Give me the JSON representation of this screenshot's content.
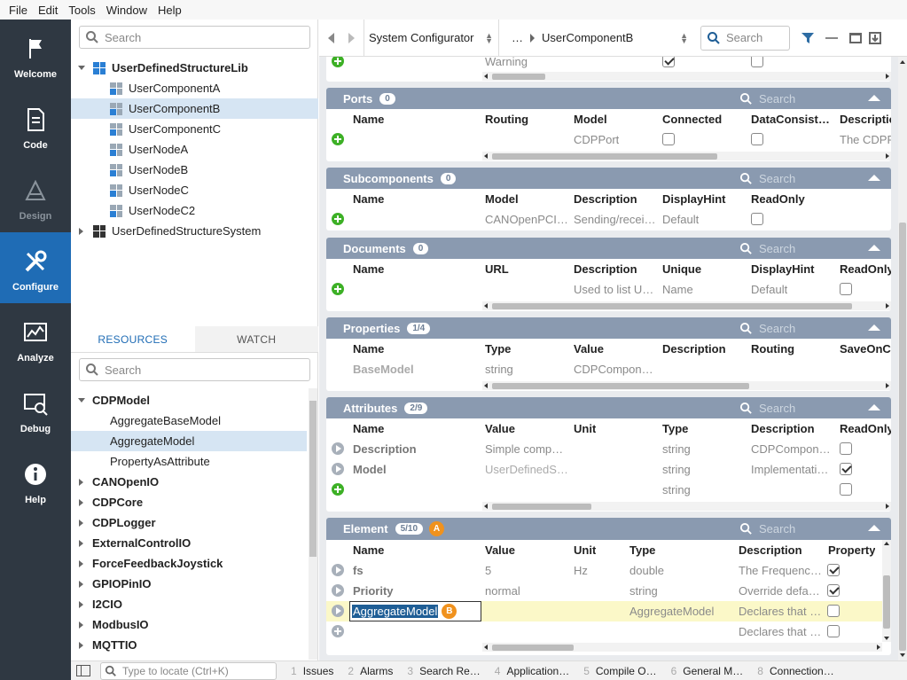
{
  "menu": {
    "file": "File",
    "edit": "Edit",
    "tools": "Tools",
    "window": "Window",
    "help": "Help"
  },
  "nav": {
    "welcome": "Welcome",
    "code": "Code",
    "design": "Design",
    "configure": "Configure",
    "analyze": "Analyze",
    "debug": "Debug",
    "help": "Help"
  },
  "tree": {
    "search_placeholder": "Search",
    "lib": "UserDefinedStructureLib",
    "items": [
      "UserComponentA",
      "UserComponentB",
      "UserComponentC",
      "UserNodeA",
      "UserNodeB",
      "UserNodeC",
      "UserNodeC2"
    ],
    "system": "UserDefinedStructureSystem"
  },
  "restabs": {
    "resources": "RESOURCES",
    "watch": "WATCH"
  },
  "resources": {
    "search_placeholder": "Search",
    "group": "CDPModel",
    "children": [
      "AggregateBaseModel",
      "AggregateModel",
      "PropertyAsAttribute"
    ],
    "others": [
      "CANOpenIO",
      "CDPCore",
      "CDPLogger",
      "ExternalControlIO",
      "ForceFeedbackJoystick",
      "GPIOPinIO",
      "I2CIO",
      "ModbusIO",
      "MQTTIO"
    ]
  },
  "topbar": {
    "crumb1": "System Configurator",
    "ellipsis": "…",
    "crumb2": "UserComponentB",
    "search_placeholder": "Search"
  },
  "top_partial": {
    "value": "Warning"
  },
  "ports": {
    "title": "Ports",
    "count": "0",
    "search": "Search",
    "headers": [
      "Name",
      "Routing",
      "Model",
      "Connected",
      "DataConsiste…",
      "Descriptio"
    ],
    "row": {
      "model": "CDPPort",
      "desc": "The CDPP"
    }
  },
  "subcomponents": {
    "title": "Subcomponents",
    "count": "0",
    "search": "Search",
    "headers": [
      "Name",
      "Model",
      "Description",
      "DisplayHint",
      "ReadOnly"
    ],
    "row": {
      "model": "CANOpenPCI…",
      "desc": "Sending/recei…",
      "hint": "Default"
    }
  },
  "documents": {
    "title": "Documents",
    "count": "0",
    "search": "Search",
    "headers": [
      "Name",
      "URL",
      "Description",
      "Unique",
      "DisplayHint",
      "ReadOnly"
    ],
    "row": {
      "desc": "Used to list U…",
      "unique": "Name",
      "hint": "Default"
    }
  },
  "properties": {
    "title": "Properties",
    "count": "1/4",
    "search": "Search",
    "headers": [
      "Name",
      "Type",
      "Value",
      "Description",
      "Routing",
      "SaveOnCh"
    ],
    "row": {
      "name": "BaseModel",
      "type": "string",
      "value": "CDPCompon…"
    }
  },
  "attributes": {
    "title": "Attributes",
    "count": "2/9",
    "search": "Search",
    "headers": [
      "Name",
      "Value",
      "Unit",
      "Type",
      "Description",
      "ReadOnly"
    ],
    "rows": [
      {
        "name": "Description",
        "value": "Simple comp…",
        "type": "string",
        "desc": "CDPCompon…"
      },
      {
        "name": "Model",
        "value": "UserDefinedS…",
        "type": "string",
        "desc": "Implementati…"
      },
      {
        "type": "string"
      }
    ]
  },
  "element": {
    "title": "Element",
    "count": "5/10",
    "marker_a": "A",
    "marker_b": "B",
    "search": "Search",
    "headers": [
      "Name",
      "Value",
      "Unit",
      "Type",
      "Description",
      "Property"
    ],
    "rows": [
      {
        "name": "fs",
        "value": "5",
        "unit": "Hz",
        "type": "double",
        "desc": "The Frequenc…"
      },
      {
        "name": "Priority",
        "value": "normal",
        "type": "string",
        "desc": "Override defa…"
      },
      {
        "name": "AggregateModel",
        "type": "AggregateModel",
        "desc": "Declares that …"
      },
      {
        "desc": "Declares that …"
      }
    ]
  },
  "bottom": {
    "locate_placeholder": "Type to locate (Ctrl+K)",
    "tabs": [
      {
        "n": "1",
        "label": "Issues"
      },
      {
        "n": "2",
        "label": "Alarms"
      },
      {
        "n": "3",
        "label": "Search Re…"
      },
      {
        "n": "4",
        "label": "Application…"
      },
      {
        "n": "5",
        "label": "Compile O…"
      },
      {
        "n": "6",
        "label": "General M…"
      },
      {
        "n": "8",
        "label": "Connection…"
      }
    ]
  }
}
